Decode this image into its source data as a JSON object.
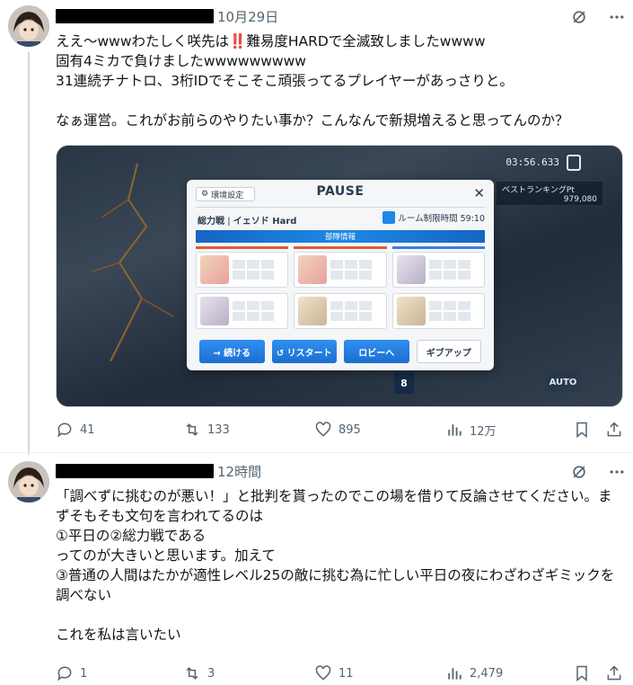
{
  "tweets": [
    {
      "time": "10月29日",
      "text": "ええ〜wwwわたしく咲先は‼️難易度HARDで全滅致しましたwwww\n固有4ミカで負けましたwwwwwwwww\n31連続チナトロ、3桁IDでそこそこ頑張ってるプレイヤーがあっさりと。\n\nなぁ運営。これがお前らのやりたい事か？こんなんで新規増えると思ってんのか？",
      "stats": {
        "replies": "41",
        "retweets": "133",
        "likes": "895",
        "views": "12万"
      },
      "media": {
        "timer": "03:56.633",
        "rank_label": "ベストランキングPt",
        "rank_value": "979,080",
        "auto": "AUTO",
        "cost": "8",
        "dialog": {
          "settings": "環境設定",
          "title": "PAUSE",
          "close": "✕",
          "battle_prefix": "総力戦",
          "battle_name": "イェソド Hard",
          "limit": "ルーム制限時間 59:10",
          "band": "部隊情報",
          "buttons": [
            "→ 続ける",
            "↺ リスタート",
            "ロビーへ",
            "ギブアップ"
          ]
        }
      }
    },
    {
      "time": "12時間",
      "text": "「調べずに挑むのが悪い！」と批判を貰ったのでこの場を借りて反論させてください。まずそもそも文句を言われてるのは\n①平日の②総力戦である\nってのが大きいと思います。加えて\n③普通の人間はたかが適性レベル25の敵に挑む為に忙しい平日の夜にわざわざギミックを調べない\n\nこれを私は言いたい",
      "stats": {
        "replies": "1",
        "retweets": "3",
        "likes": "11",
        "views": "2,479"
      }
    }
  ],
  "icons": {
    "reply": "reply-icon",
    "retweet": "retweet-icon",
    "like": "heart-icon",
    "views": "views-icon",
    "bookmark": "bookmark-icon",
    "share": "share-icon",
    "grok": "grok-icon",
    "more": "more-icon"
  },
  "colors": {
    "text": "#0f1419",
    "muted": "#536471",
    "divider": "#eff3f4"
  }
}
